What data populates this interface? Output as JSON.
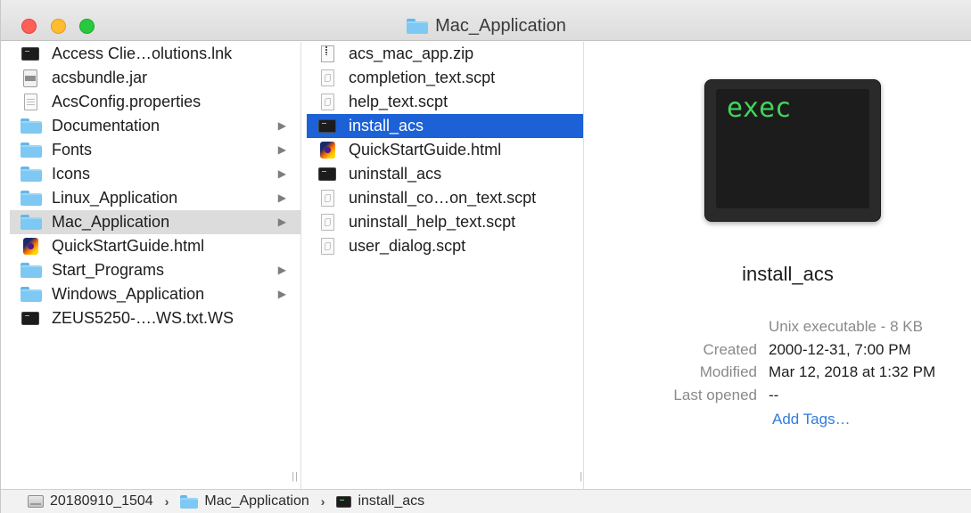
{
  "window": {
    "title": "Mac_Application"
  },
  "column1": {
    "items": [
      {
        "label": "Access Clie…olutions.lnk",
        "icon": "terminal-icon",
        "has_children": false,
        "state": "normal"
      },
      {
        "label": "acsbundle.jar",
        "icon": "jar-icon",
        "has_children": false,
        "state": "normal"
      },
      {
        "label": "AcsConfig.properties",
        "icon": "document-icon",
        "has_children": false,
        "state": "normal"
      },
      {
        "label": "Documentation",
        "icon": "folder-icon",
        "has_children": true,
        "state": "normal"
      },
      {
        "label": "Fonts",
        "icon": "folder-icon",
        "has_children": true,
        "state": "normal"
      },
      {
        "label": "Icons",
        "icon": "folder-icon",
        "has_children": true,
        "state": "normal"
      },
      {
        "label": "Linux_Application",
        "icon": "folder-icon",
        "has_children": true,
        "state": "normal"
      },
      {
        "label": "Mac_Application",
        "icon": "folder-icon",
        "has_children": true,
        "state": "selected-inactive"
      },
      {
        "label": "QuickStartGuide.html",
        "icon": "firefox-icon",
        "has_children": false,
        "state": "normal"
      },
      {
        "label": "Start_Programs",
        "icon": "folder-icon",
        "has_children": true,
        "state": "normal"
      },
      {
        "label": "Windows_Application",
        "icon": "folder-icon",
        "has_children": true,
        "state": "normal"
      },
      {
        "label": "ZEUS5250-….WS.txt.WS",
        "icon": "terminal-icon",
        "has_children": false,
        "state": "normal"
      }
    ]
  },
  "column2": {
    "items": [
      {
        "label": "acs_mac_app.zip",
        "icon": "zip-icon",
        "state": "normal"
      },
      {
        "label": "completion_text.scpt",
        "icon": "script-icon",
        "state": "normal"
      },
      {
        "label": "help_text.scpt",
        "icon": "script-icon",
        "state": "normal"
      },
      {
        "label": "install_acs",
        "icon": "terminal-icon",
        "state": "selected-active"
      },
      {
        "label": "QuickStartGuide.html",
        "icon": "firefox-icon",
        "state": "normal"
      },
      {
        "label": "uninstall_acs",
        "icon": "terminal-icon",
        "state": "normal"
      },
      {
        "label": "uninstall_co…on_text.scpt",
        "icon": "script-icon",
        "state": "normal"
      },
      {
        "label": "uninstall_help_text.scpt",
        "icon": "script-icon",
        "state": "normal"
      },
      {
        "label": "user_dialog.scpt",
        "icon": "script-icon",
        "state": "normal"
      }
    ]
  },
  "preview": {
    "icon_text": "exec",
    "name": "install_acs",
    "kind": "Unix executable - 8 KB",
    "created_label": "Created",
    "created_value": "2000-12-31, 7:00 PM",
    "modified_label": "Modified",
    "modified_value": "Mar 12, 2018 at 1:32 PM",
    "last_opened_label": "Last opened",
    "last_opened_value": "--",
    "add_tags": "Add Tags…"
  },
  "pathbar": {
    "segments": [
      {
        "label": "20180910_1504",
        "icon": "hard-drive-icon"
      },
      {
        "label": "Mac_Application",
        "icon": "folder-icon"
      },
      {
        "label": "install_acs",
        "icon": "terminal-icon"
      }
    ],
    "separator": "›"
  },
  "colors": {
    "selection_active": "#1c61d6",
    "selection_inactive": "#dcdcdc",
    "folder": "#7ec8f4",
    "link": "#2f7ce0",
    "exec_green": "#43d55b"
  }
}
